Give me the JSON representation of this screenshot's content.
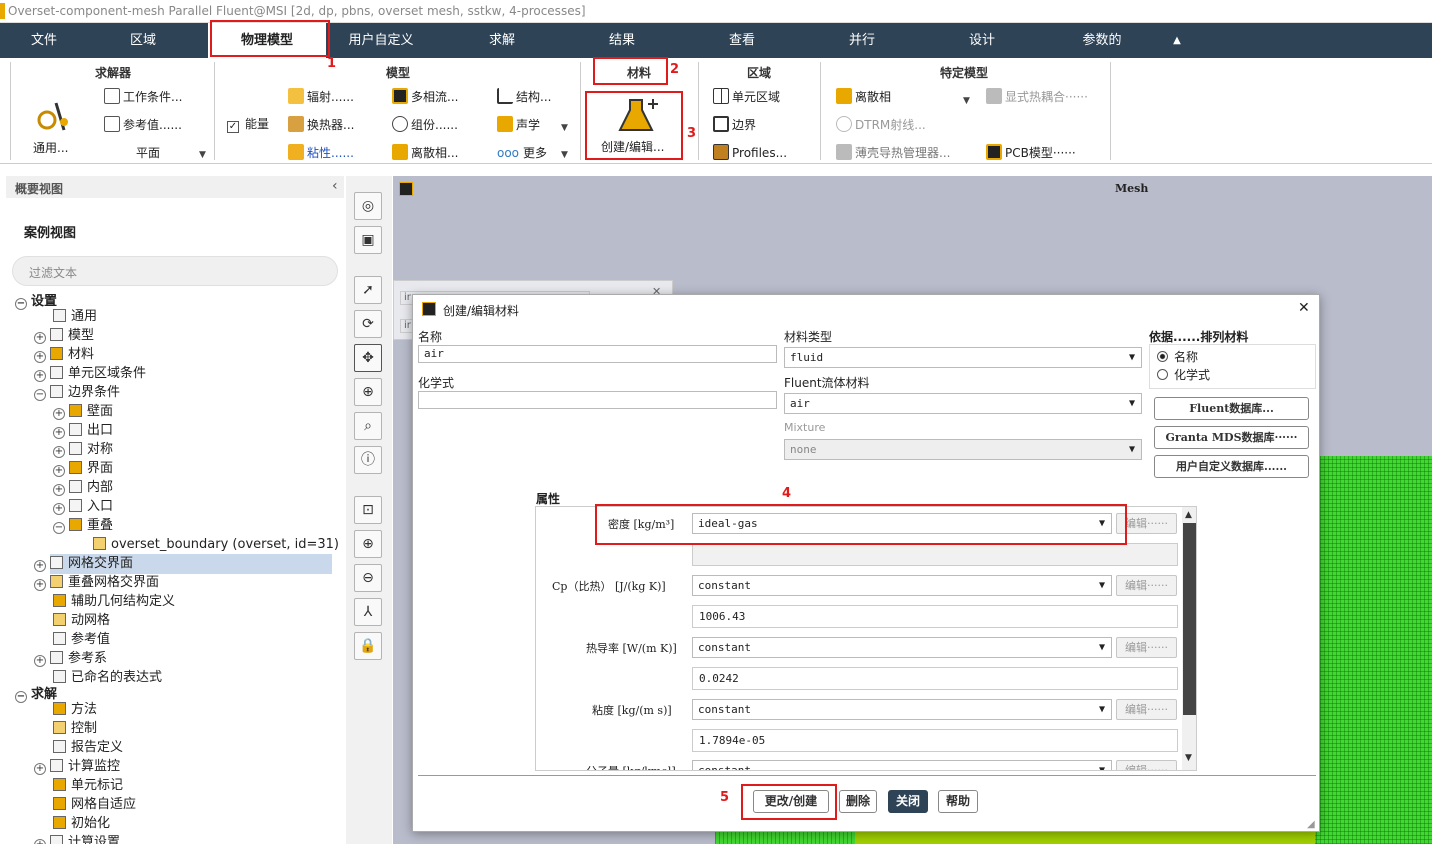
{
  "window": {
    "title": "Overset-component-mesh Parallel Fluent@MSI  [2d, dp, pbns, overset mesh, sstkw, 4-processes]"
  },
  "menubar": {
    "tabs": [
      "文件",
      "区域",
      "物理模型",
      "用户自定义",
      "求解",
      "结果",
      "查看",
      "并行",
      "设计",
      "参数的"
    ],
    "active": "物理模型",
    "collapse_icon": "▲"
  },
  "ribbon": {
    "solver": {
      "title": "求解器",
      "general": "通用...",
      "conditions": "工作条件...",
      "reference": "参考值......",
      "plane": "平面"
    },
    "models": {
      "title": "模型",
      "energy": "能量",
      "energy_checked": true,
      "radiation": "辐射......",
      "heat_exchanger": "换热器...",
      "viscous": "粘性......",
      "multiphase": "多相流...",
      "species": "组份......",
      "discrete_phase": "离散相...",
      "structure": "结构...",
      "acoustics": "声学",
      "more": "更多"
    },
    "materials": {
      "title": "材料",
      "create_edit": "创建/编辑..."
    },
    "zones": {
      "title": "区域",
      "cell_zone": "单元区域",
      "boundary": "边界",
      "profiles": "Profiles..."
    },
    "specific": {
      "title": "特定模型",
      "dpm": "离散相",
      "dtrm": "DTRM射线...",
      "shell": "薄壳导热管理器...",
      "thermal_coupling": "显式热耦合······",
      "pcb": "PCB模型······"
    }
  },
  "annotations": [
    "1",
    "2",
    "3",
    "4",
    "5"
  ],
  "outline": {
    "header": "概要视图",
    "collapse": "‹",
    "case_view": "案例视图",
    "filter_placeholder": "过滤文本",
    "tree": {
      "setup": "设置",
      "general": "通用",
      "models": "模型",
      "materials": "材料",
      "cell_zones": "单元区域条件",
      "boundaries": "边界条件",
      "wall": "壁面",
      "outlet": "出口",
      "symmetry": "对称",
      "interface": "界面",
      "interior": "内部",
      "inlet": "入口",
      "overset": "重叠",
      "overset_boundary": "overset_boundary (overset, id=31)",
      "mesh_interfaces": "网格交界面",
      "overset_interfaces": "重叠网格交界面",
      "geometry": "辅助几何结构定义",
      "dynamic_mesh": "动网格",
      "reference_values": "参考值",
      "reference_frames": "参考系",
      "named_expressions": "已命名的表达式",
      "solution": "求解",
      "methods": "方法",
      "controls": "控制",
      "report_definitions": "报告定义",
      "monitors": "计算监控",
      "cell_registers": "单元标记",
      "adaption": "网格自适应",
      "initialization": "初始化",
      "calculation": "计算设置"
    }
  },
  "graphics": {
    "title": "Mesh",
    "bg_tab_text": "ir"
  },
  "dialog": {
    "title": "创建/编辑材料",
    "close": "✕",
    "name_label": "名称",
    "name_value": "air",
    "formula_label": "化学式",
    "formula_value": "",
    "material_type_label": "材料类型",
    "material_type": "fluid",
    "fluent_materials_label": "Fluent流体材料",
    "fluent_material": "air",
    "mixture_label": "Mixture",
    "mixture": "none",
    "order_label": "依据......排列材料",
    "order_name": "名称",
    "order_formula": "化学式",
    "order_selected": "名称",
    "db_fluent": "Fluent数据库...",
    "db_granta": "Granta MDS数据库······",
    "db_user": "用户自定义数据库......",
    "properties_label": "属性",
    "properties": [
      {
        "label": "密度 [kg/m³]",
        "method": "ideal-gas",
        "value": "",
        "edit": "编辑······"
      },
      {
        "label": "Cp（比热） [J/(kg K)]",
        "method": "constant",
        "value": "1006.43",
        "edit": "编辑······"
      },
      {
        "label": "热导率 [W/(m K)]",
        "method": "constant",
        "value": "0.0242",
        "edit": "编辑······"
      },
      {
        "label": "粘度 [kg/(m s)]",
        "method": "constant",
        "value": "1.7894e-05",
        "edit": "编辑······"
      },
      {
        "label": "分子量 [kg/kmol]",
        "method": "constant",
        "value": "",
        "edit": "编辑······"
      }
    ],
    "buttons": {
      "change_create": "更改/创建",
      "delete": "删除",
      "close": "关闭",
      "help": "帮助"
    }
  },
  "colors": {
    "menubar": "#2e4356",
    "annotation_red": "#e01b1b",
    "mesh_green": "#42d832"
  }
}
